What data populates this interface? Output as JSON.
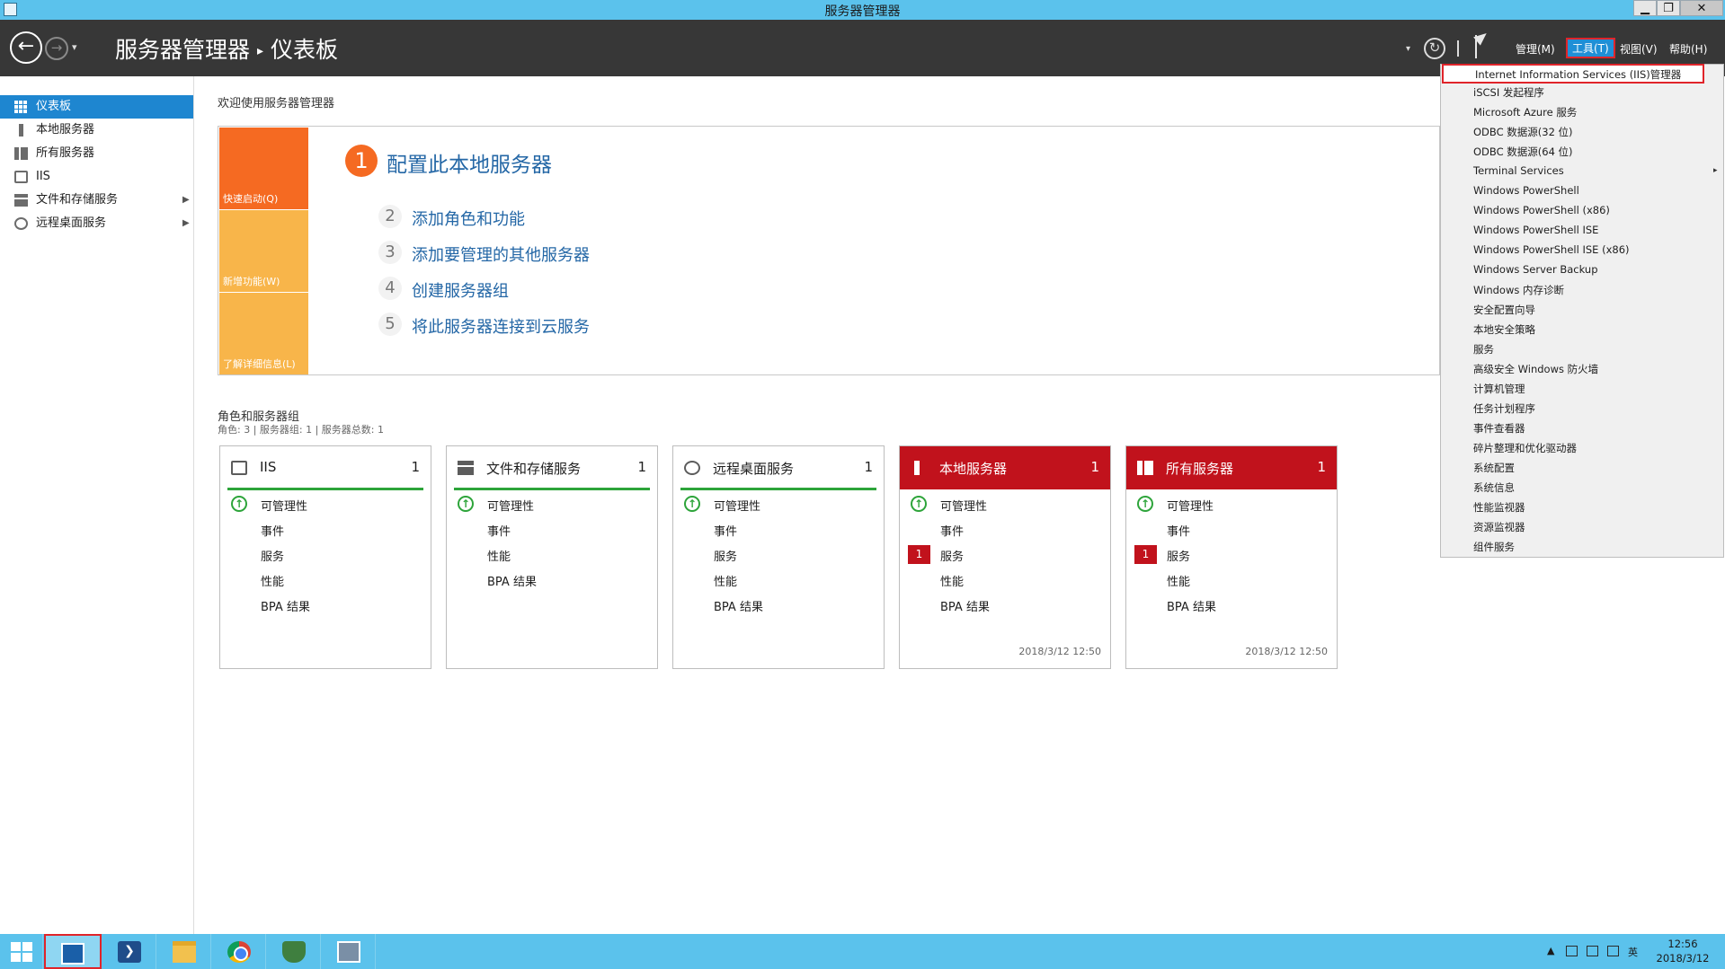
{
  "window": {
    "title": "服务器管理器",
    "controls": {
      "minimize": "▁",
      "restore": "❐",
      "close": "✕"
    }
  },
  "header": {
    "back_glyph": "←",
    "forward_glyph": "→",
    "dropdown_glyph": "▾",
    "breadcrumb": {
      "root": "服务器管理器",
      "separator": "▸",
      "current": "仪表板"
    },
    "refresh_glyph": "↻",
    "menus": {
      "manage": "管理(M)",
      "tools": "工具(T)",
      "view": "视图(V)",
      "help": "帮助(H)"
    }
  },
  "sidebar": {
    "items": [
      {
        "label": "仪表板",
        "icon": "dashboard-icon",
        "active": true
      },
      {
        "label": "本地服务器",
        "icon": "server-icon"
      },
      {
        "label": "所有服务器",
        "icon": "servers-icon"
      },
      {
        "label": "IIS",
        "icon": "iis-icon"
      },
      {
        "label": "文件和存储服务",
        "icon": "storage-icon",
        "expandable": true
      },
      {
        "label": "远程桌面服务",
        "icon": "remote-desktop-icon",
        "expandable": true
      }
    ],
    "expand_glyph": "▶"
  },
  "main": {
    "welcome": "欢迎使用服务器管理器",
    "quick_start": {
      "tiles": [
        "快速启动(Q)",
        "新增功能(W)",
        "了解详细信息(L)"
      ],
      "steps": [
        {
          "num": "1",
          "text": "配置此本地服务器"
        },
        {
          "num": "2",
          "text": "添加角色和功能"
        },
        {
          "num": "3",
          "text": "添加要管理的其他服务器"
        },
        {
          "num": "4",
          "text": "创建服务器组"
        },
        {
          "num": "5",
          "text": "将此服务器连接到云服务"
        }
      ]
    },
    "roles": {
      "title": "角色和服务器组",
      "summary": "角色: 3 | 服务器组: 1 | 服务器总数: 1",
      "ok_glyph": "↑",
      "cards": [
        {
          "name": "IIS",
          "count": "1",
          "rows": [
            "可管理性",
            "事件",
            "服务",
            "性能",
            "BPA 结果"
          ],
          "stamp": ""
        },
        {
          "name": "文件和存储服务",
          "count": "1",
          "rows": [
            "可管理性",
            "事件",
            "性能",
            "BPA 结果"
          ],
          "stamp": ""
        },
        {
          "name": "远程桌面服务",
          "count": "1",
          "rows": [
            "可管理性",
            "事件",
            "服务",
            "性能",
            "BPA 结果"
          ],
          "stamp": ""
        },
        {
          "name": "本地服务器",
          "count": "1",
          "rows": [
            "可管理性",
            "事件",
            "服务",
            "性能",
            "BPA 结果"
          ],
          "alert_count": "1",
          "stamp": "2018/3/12 12:50"
        },
        {
          "name": "所有服务器",
          "count": "1",
          "rows": [
            "可管理性",
            "事件",
            "服务",
            "性能",
            "BPA 结果"
          ],
          "alert_count": "1",
          "stamp": "2018/3/12 12:50"
        }
      ]
    }
  },
  "tools_menu": {
    "items": [
      "Internet Information Services (IIS)管理器",
      "iSCSI 发起程序",
      "Microsoft Azure 服务",
      "ODBC 数据源(32 位)",
      "ODBC 数据源(64 位)",
      "Terminal Services",
      "Windows PowerShell",
      "Windows PowerShell (x86)",
      "Windows PowerShell ISE",
      "Windows PowerShell ISE (x86)",
      "Windows Server Backup",
      "Windows 内存诊断",
      "安全配置向导",
      "本地安全策略",
      "服务",
      "高级安全 Windows 防火墙",
      "计算机管理",
      "任务计划程序",
      "事件查看器",
      "碎片整理和优化驱动器",
      "系统配置",
      "系统信息",
      "性能监视器",
      "资源监视器",
      "组件服务"
    ],
    "submenu_glyph": "▸"
  },
  "taskbar": {
    "ps_glyph": "❯",
    "tray": {
      "chevron": "▲",
      "ime": "英"
    },
    "clock": {
      "time": "12:56",
      "date": "2018/3/12"
    }
  },
  "colors": {
    "accent_blue": "#1e86d0",
    "alert_red": "#c1121c",
    "ok_green": "#2da43a",
    "quick_start_orange": "#f56a22"
  }
}
